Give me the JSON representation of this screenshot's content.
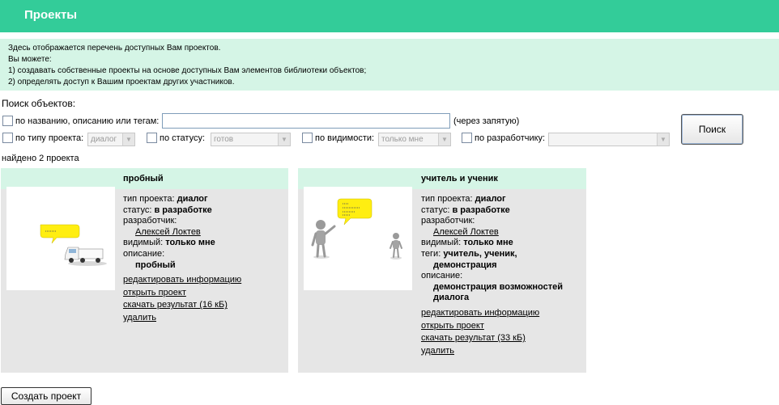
{
  "header": {
    "title": "Проекты"
  },
  "info": {
    "lines": [
      "Здесь отображается перечень доступных Вам проектов.",
      "Вы можете:",
      "1) создавать собственные проекты на основе доступных Вам элементов библиотеки объектов;",
      "2) определять доступ к Вашим проектам других участников."
    ]
  },
  "search": {
    "title": "Поиск объектов:",
    "by_name_label": "по названию, описанию или тегам:",
    "name_value": "",
    "hint": "(через запятую)",
    "by_type_label": "по типу проекта:",
    "type_value": "диалог",
    "by_status_label": "по статусу:",
    "status_value": "готов",
    "by_visibility_label": "по видимости:",
    "visibility_value": "только мне",
    "by_developer_label": "по разработчику:",
    "developer_value": "",
    "button": "Поиск"
  },
  "found_text": "найдено 2 проекта",
  "projects": [
    {
      "title": "пробный",
      "type_label": "тип проекта:",
      "type": "диалог",
      "status_label": "статус:",
      "status": "в разработке",
      "developer_label": "разработчик:",
      "developer": "Алексей Локтев",
      "visible_label": "видимый:",
      "visible": "только мне",
      "description_label": "описание:",
      "description": "пробный",
      "actions": [
        "редактировать информацию",
        "открыть проект",
        "скачать результат (16 кБ)",
        "удалить"
      ]
    },
    {
      "title": "учитель и ученик",
      "type_label": "тип проекта:",
      "type": "диалог",
      "status_label": "статус:",
      "status": "в разработке",
      "developer_label": "разработчик:",
      "developer": "Алексей Локтев",
      "visible_label": "видимый:",
      "visible": "только мне",
      "tags_label": "теги:",
      "tags_line1": "учитель, ученик,",
      "tags_line2": "демонстрация",
      "description_label": "описание:",
      "description_line1": "демонстрация возможностей",
      "description_line2": "диалога",
      "actions": [
        "редактировать информацию",
        "открыть проект",
        "скачать результат (33 кБ)",
        "удалить"
      ]
    }
  ],
  "create_button": "Создать проект",
  "colors": {
    "header": "#33cc99",
    "info_bg": "#d5f5e6",
    "card_bg": "#e6e6e6"
  }
}
